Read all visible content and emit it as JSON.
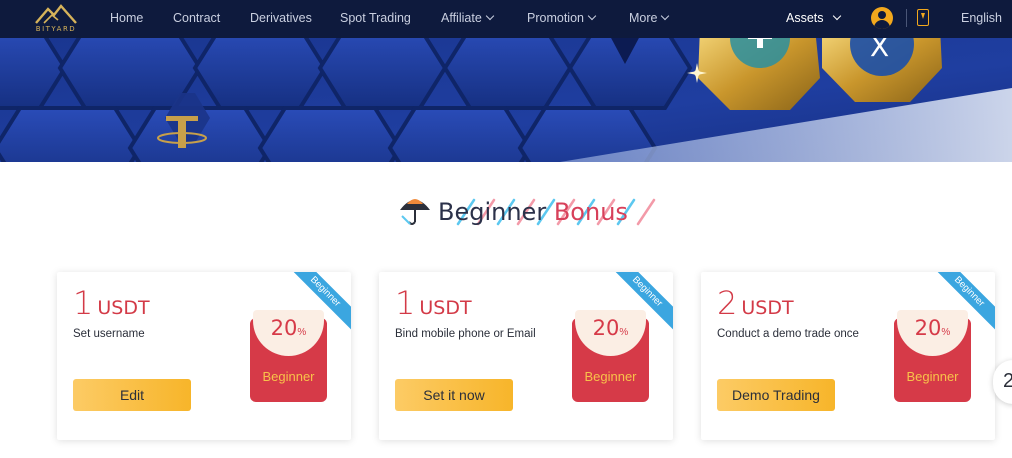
{
  "brand": {
    "logo_text": "BITYARD"
  },
  "nav": {
    "items": [
      {
        "label": "Home"
      },
      {
        "label": "Contract"
      },
      {
        "label": "Derivatives"
      },
      {
        "label": "Spot Trading"
      },
      {
        "label": "Affiliate"
      },
      {
        "label": "Promotion"
      },
      {
        "label": "More"
      }
    ],
    "assets_label": "Assets",
    "language_label": "English"
  },
  "colors": {
    "nav_bg": "#0e1a3d",
    "accent_gold": "#f2a81d",
    "accent_red": "#d33a47",
    "ribbon_blue": "#3ba6e0"
  },
  "section": {
    "title_part1": "Beginner",
    "title_part2": "Bonus"
  },
  "cards": [
    {
      "amount": "1",
      "unit": "USDT",
      "task": "Set username",
      "button": "Edit",
      "percent": "20",
      "percent_sign": "%",
      "envelope_label": "Beginner",
      "ribbon": "Beginner"
    },
    {
      "amount": "1",
      "unit": "USDT",
      "task": "Bind mobile phone or Email",
      "button": "Set it now",
      "percent": "20",
      "percent_sign": "%",
      "envelope_label": "Beginner",
      "ribbon": "Beginner"
    },
    {
      "amount": "2",
      "unit": "USDT",
      "task": "Conduct a demo trade once",
      "button": "Demo Trading",
      "percent": "20",
      "percent_sign": "%",
      "envelope_label": "Beginner",
      "ribbon": "Beginner"
    }
  ],
  "floating_button": {
    "label": "2"
  },
  "icons": {
    "logo": "mountain-logo-icon",
    "chevron": "chevron-down-icon",
    "avatar": "user-avatar-icon",
    "download": "download-app-icon",
    "umbrella": "umbrella-icon"
  }
}
